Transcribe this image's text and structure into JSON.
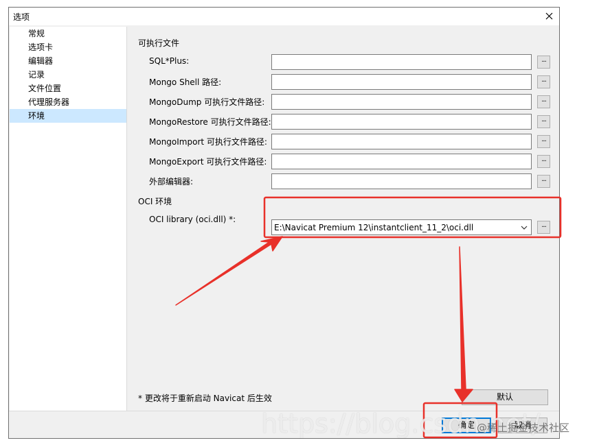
{
  "window": {
    "title": "选项"
  },
  "nav": {
    "items": [
      {
        "label": "常规"
      },
      {
        "label": "选项卡"
      },
      {
        "label": "编辑器"
      },
      {
        "label": "记录"
      },
      {
        "label": "文件位置"
      },
      {
        "label": "代理服务器"
      },
      {
        "label": "环境",
        "selected": true
      }
    ]
  },
  "sections": {
    "executables_title": "可执行文件",
    "oci_title": "OCI 环境"
  },
  "fields": [
    {
      "label": "SQL*Plus:",
      "value": ""
    },
    {
      "label": "Mongo Shell 路径:",
      "value": ""
    },
    {
      "label": "MongoDump 可执行文件路径:",
      "value": ""
    },
    {
      "label": "MongoRestore 可执行文件路径:",
      "value": ""
    },
    {
      "label": "MongoImport 可执行文件路径:",
      "value": ""
    },
    {
      "label": "MongoExport 可执行文件路径:",
      "value": ""
    },
    {
      "label": "外部编辑器:",
      "value": ""
    }
  ],
  "oci": {
    "label": "OCI library (oci.dll) *:",
    "value": "E:\\Navicat Premium 12\\instantclient_11_2\\oci.dll"
  },
  "browse_label": "...",
  "note": "* 更改将于重新启动 Navicat 后生效",
  "buttons": {
    "default": "默认",
    "ok": "确定",
    "cancel": "取消"
  },
  "watermark": {
    "url": "https://blog.csdn.net/...",
    "community": "@稀土掘金技术社区"
  },
  "colors": {
    "selection": "#cce8ff",
    "annotation": "#e8312a",
    "focus_border": "#0078d7"
  }
}
